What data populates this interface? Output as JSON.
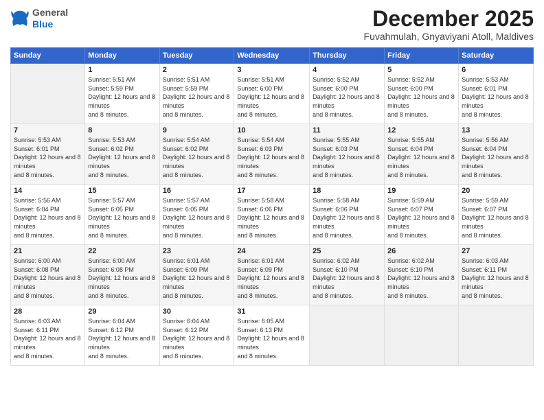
{
  "logo": {
    "general": "General",
    "blue": "Blue"
  },
  "header": {
    "month": "December 2025",
    "location": "Fuvahmulah, Gnyaviyani Atoll, Maldives"
  },
  "days_of_week": [
    "Sunday",
    "Monday",
    "Tuesday",
    "Wednesday",
    "Thursday",
    "Friday",
    "Saturday"
  ],
  "weeks": [
    [
      null,
      {
        "num": "1",
        "sunrise": "5:51 AM",
        "sunset": "5:59 PM",
        "daylight": "12 hours and 8 minutes."
      },
      {
        "num": "2",
        "sunrise": "5:51 AM",
        "sunset": "5:59 PM",
        "daylight": "12 hours and 8 minutes."
      },
      {
        "num": "3",
        "sunrise": "5:51 AM",
        "sunset": "6:00 PM",
        "daylight": "12 hours and 8 minutes."
      },
      {
        "num": "4",
        "sunrise": "5:52 AM",
        "sunset": "6:00 PM",
        "daylight": "12 hours and 8 minutes."
      },
      {
        "num": "5",
        "sunrise": "5:52 AM",
        "sunset": "6:00 PM",
        "daylight": "12 hours and 8 minutes."
      },
      {
        "num": "6",
        "sunrise": "5:53 AM",
        "sunset": "6:01 PM",
        "daylight": "12 hours and 8 minutes."
      }
    ],
    [
      {
        "num": "7",
        "sunrise": "5:53 AM",
        "sunset": "6:01 PM",
        "daylight": "12 hours and 8 minutes."
      },
      {
        "num": "8",
        "sunrise": "5:53 AM",
        "sunset": "6:02 PM",
        "daylight": "12 hours and 8 minutes."
      },
      {
        "num": "9",
        "sunrise": "5:54 AM",
        "sunset": "6:02 PM",
        "daylight": "12 hours and 8 minutes."
      },
      {
        "num": "10",
        "sunrise": "5:54 AM",
        "sunset": "6:03 PM",
        "daylight": "12 hours and 8 minutes."
      },
      {
        "num": "11",
        "sunrise": "5:55 AM",
        "sunset": "6:03 PM",
        "daylight": "12 hours and 8 minutes."
      },
      {
        "num": "12",
        "sunrise": "5:55 AM",
        "sunset": "6:04 PM",
        "daylight": "12 hours and 8 minutes."
      },
      {
        "num": "13",
        "sunrise": "5:56 AM",
        "sunset": "6:04 PM",
        "daylight": "12 hours and 8 minutes."
      }
    ],
    [
      {
        "num": "14",
        "sunrise": "5:56 AM",
        "sunset": "6:04 PM",
        "daylight": "12 hours and 8 minutes."
      },
      {
        "num": "15",
        "sunrise": "5:57 AM",
        "sunset": "6:05 PM",
        "daylight": "12 hours and 8 minutes."
      },
      {
        "num": "16",
        "sunrise": "5:57 AM",
        "sunset": "6:05 PM",
        "daylight": "12 hours and 8 minutes."
      },
      {
        "num": "17",
        "sunrise": "5:58 AM",
        "sunset": "6:06 PM",
        "daylight": "12 hours and 8 minutes."
      },
      {
        "num": "18",
        "sunrise": "5:58 AM",
        "sunset": "6:06 PM",
        "daylight": "12 hours and 8 minutes."
      },
      {
        "num": "19",
        "sunrise": "5:59 AM",
        "sunset": "6:07 PM",
        "daylight": "12 hours and 8 minutes."
      },
      {
        "num": "20",
        "sunrise": "5:59 AM",
        "sunset": "6:07 PM",
        "daylight": "12 hours and 8 minutes."
      }
    ],
    [
      {
        "num": "21",
        "sunrise": "6:00 AM",
        "sunset": "6:08 PM",
        "daylight": "12 hours and 8 minutes."
      },
      {
        "num": "22",
        "sunrise": "6:00 AM",
        "sunset": "6:08 PM",
        "daylight": "12 hours and 8 minutes."
      },
      {
        "num": "23",
        "sunrise": "6:01 AM",
        "sunset": "6:09 PM",
        "daylight": "12 hours and 8 minutes."
      },
      {
        "num": "24",
        "sunrise": "6:01 AM",
        "sunset": "6:09 PM",
        "daylight": "12 hours and 8 minutes."
      },
      {
        "num": "25",
        "sunrise": "6:02 AM",
        "sunset": "6:10 PM",
        "daylight": "12 hours and 8 minutes."
      },
      {
        "num": "26",
        "sunrise": "6:02 AM",
        "sunset": "6:10 PM",
        "daylight": "12 hours and 8 minutes."
      },
      {
        "num": "27",
        "sunrise": "6:03 AM",
        "sunset": "6:11 PM",
        "daylight": "12 hours and 8 minutes."
      }
    ],
    [
      {
        "num": "28",
        "sunrise": "6:03 AM",
        "sunset": "6:11 PM",
        "daylight": "12 hours and 8 minutes."
      },
      {
        "num": "29",
        "sunrise": "6:04 AM",
        "sunset": "6:12 PM",
        "daylight": "12 hours and 8 minutes."
      },
      {
        "num": "30",
        "sunrise": "6:04 AM",
        "sunset": "6:12 PM",
        "daylight": "12 hours and 8 minutes."
      },
      {
        "num": "31",
        "sunrise": "6:05 AM",
        "sunset": "6:13 PM",
        "daylight": "12 hours and 8 minutes."
      },
      null,
      null,
      null
    ]
  ],
  "labels": {
    "sunrise": "Sunrise:",
    "sunset": "Sunset:",
    "daylight": "Daylight:"
  }
}
